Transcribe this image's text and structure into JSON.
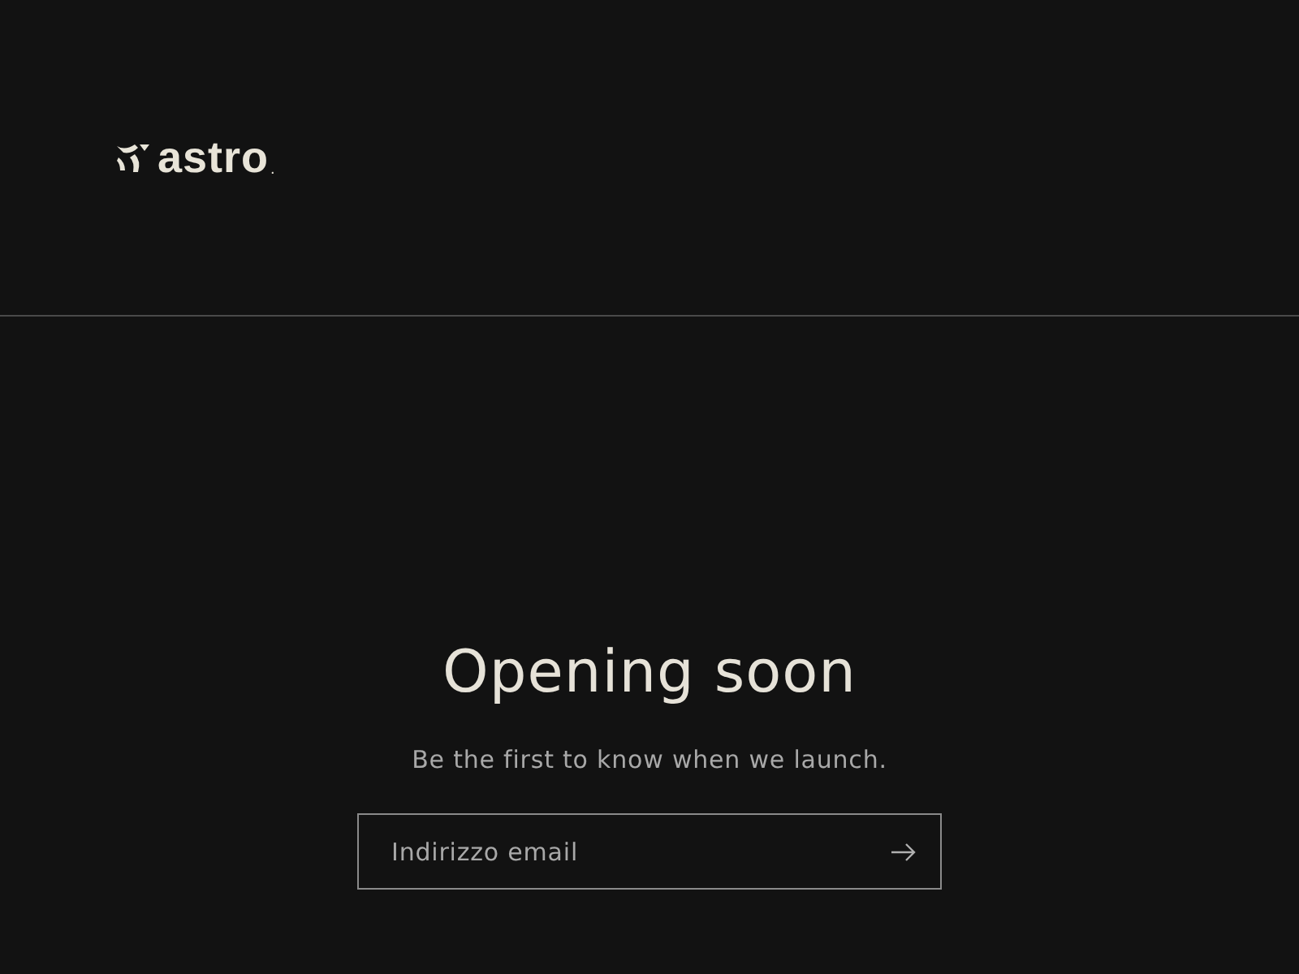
{
  "header": {
    "logo": "astro",
    "logo_mark": "."
  },
  "hero": {
    "title": "Opening soon",
    "subtitle": "Be the first to know when we launch.",
    "email_field": {
      "placeholder": "Indirizzo email"
    }
  }
}
